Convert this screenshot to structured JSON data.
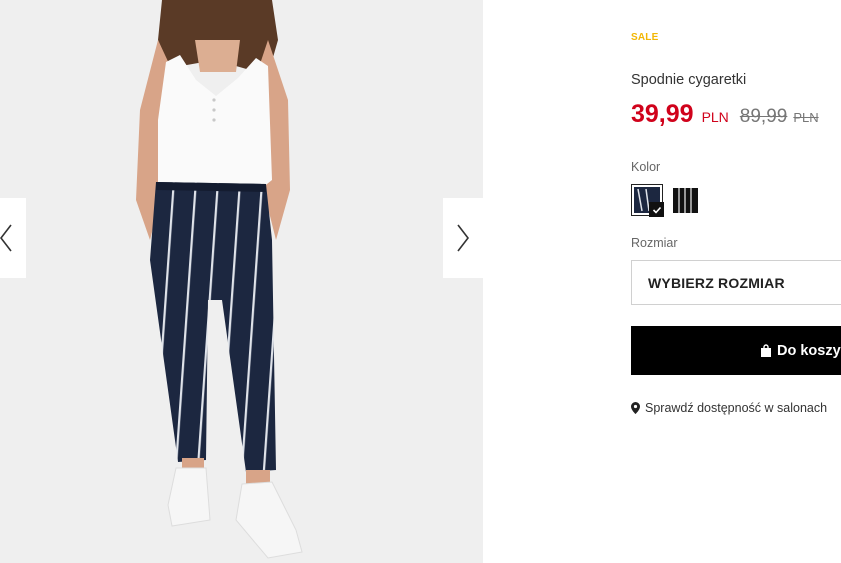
{
  "product": {
    "badge": "SALE",
    "name": "Spodnie cygaretki",
    "price_current": "39,99",
    "currency_current": "PLN",
    "price_old": "89,99",
    "currency_old": "PLN"
  },
  "options": {
    "color_label": "Kolor",
    "size_label": "Rozmiar",
    "size_placeholder": "WYBIERZ ROZMIAR"
  },
  "actions": {
    "add_to_cart": "Do koszyka",
    "check_availability": "Sprawdź dostępność w salonach"
  },
  "icons": {
    "prev": "chevron-left-icon",
    "next": "chevron-right-icon",
    "cart": "shopping-bag-icon",
    "location": "map-marker-icon",
    "check": "checkmark-icon"
  },
  "colors": {
    "sale_badge": "#f2b705",
    "price": "#d0021b",
    "button": "#000000"
  }
}
